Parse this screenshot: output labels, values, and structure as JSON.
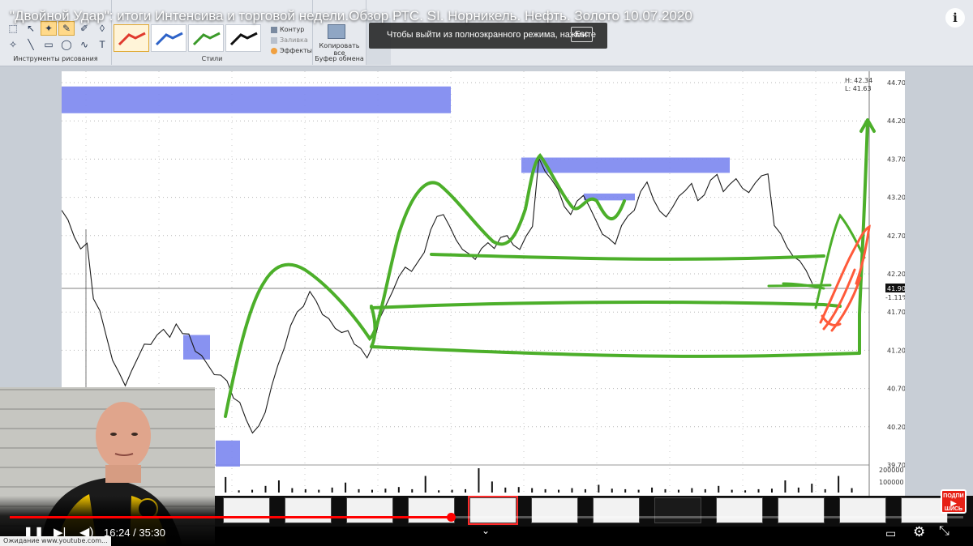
{
  "video": {
    "title": "\"Двойной Удар\": итоги Интенсива и торговой недели.Обзор РТС. SI. Норникель. Нефть. Золото 10.07.2020",
    "fullscreen_hint": "Чтобы выйти из полноэкранного режима, нажмите",
    "fullscreen_key": "Esc",
    "current_time": "16:24",
    "duration": "35:30",
    "progress": 0.4624,
    "time_separator": "/",
    "status_url": "Ожидание www.youtube.com...",
    "subscribe_label_1": "ПОДПИ",
    "subscribe_label_2": "ШИСЬ"
  },
  "ribbon": {
    "group_drawing_tools": "Инструменты рисования",
    "group_styles": "Стили",
    "group_clipboard": "Буфер обмена",
    "option_contour": "Контур",
    "option_fill": "Заливка",
    "option_effects": "Эффекты",
    "copy_all_line1": "Копировать",
    "copy_all_line2": "все",
    "style_colors": [
      "#e03a2e",
      "#2e63c8",
      "#3b9a2a",
      "#111111"
    ]
  },
  "chart_data": {
    "type": "line",
    "price_axis_labels": [
      "44.70",
      "44.20",
      "43.70",
      "43.20",
      "42.70",
      "42.20",
      "41.70",
      "41.20",
      "40.70",
      "40.20",
      "39.70"
    ],
    "volume_axis_labels": [
      "200000",
      "100000"
    ],
    "info_high": "H: 42.34",
    "info_low": "L: 41.63",
    "last_price": "41.90",
    "change_pct": "-1.11%",
    "ylim": [
      39.7,
      44.7
    ],
    "series": [
      {
        "values": [
          43.0,
          42.9,
          42.7,
          42.5,
          42.6,
          41.9,
          41.7,
          41.4,
          41.1,
          40.9,
          40.75,
          40.9,
          41.1,
          41.3,
          41.25,
          41.4,
          41.5,
          41.35,
          41.55,
          41.45,
          41.4,
          41.2,
          41.1,
          41.0,
          40.9,
          40.85,
          40.8,
          40.6,
          40.5,
          40.3,
          40.15,
          40.2,
          40.4,
          40.7,
          41.0,
          41.25,
          41.5,
          41.7,
          41.8,
          41.95,
          41.85,
          41.7,
          41.6,
          41.5,
          41.4,
          41.45,
          41.3,
          41.2,
          41.1,
          41.3,
          41.6,
          41.8,
          42.0,
          42.15,
          42.3,
          42.2,
          42.35,
          42.5,
          42.75,
          42.95,
          43.0,
          42.8,
          42.65,
          42.55,
          42.45,
          42.4,
          42.5,
          42.6,
          42.55,
          42.65,
          42.7,
          42.6,
          42.5,
          42.7,
          42.85,
          43.7,
          43.55,
          43.4,
          43.3,
          43.1,
          42.95,
          43.15,
          43.25,
          43.05,
          42.9,
          42.75,
          42.65,
          42.6,
          42.8,
          42.95,
          43.05,
          43.25,
          43.4,
          43.2,
          43.0,
          42.95,
          43.1,
          43.2,
          43.3,
          43.35,
          43.15,
          43.25,
          43.4,
          43.5,
          43.3,
          43.35,
          43.45,
          43.35,
          43.25,
          43.4,
          43.45,
          43.5,
          42.85,
          42.7,
          42.55,
          42.45,
          42.35,
          42.25,
          42.1
        ],
        "color": "#1a1a1a"
      }
    ],
    "volume_values": [
      8,
      6,
      40,
      5,
      6,
      7,
      30,
      5,
      6,
      4,
      6,
      5,
      28,
      4,
      5,
      12,
      22,
      8,
      6,
      5,
      9,
      18,
      6,
      5,
      7,
      10,
      6,
      30,
      4,
      5,
      6,
      44,
      20,
      9,
      10,
      8,
      6,
      5,
      8,
      6,
      14,
      7,
      6,
      5,
      9,
      6,
      5,
      8,
      6,
      12,
      5,
      4,
      6,
      7,
      22,
      9,
      16,
      6,
      30,
      8
    ],
    "zones": [
      {
        "x0": 0,
        "x1": 480,
        "y_top": 44.65,
        "y_bot": 44.3,
        "color": "#7b86f0"
      },
      {
        "x0": 150,
        "x1": 183,
        "y_top": 41.4,
        "y_bot": 41.08,
        "color": "#7b86f0"
      },
      {
        "x0": 190,
        "x1": 220,
        "y_top": 40.02,
        "y_bot": 39.68,
        "color": "#7b86f0"
      },
      {
        "x0": 567,
        "x1": 824,
        "y_top": 43.72,
        "y_bot": 43.52,
        "color": "#7b86f0"
      },
      {
        "x0": 644,
        "x1": 707,
        "y_top": 43.25,
        "y_bot": 43.16,
        "color": "#7b86f0"
      }
    ],
    "grid": true
  }
}
